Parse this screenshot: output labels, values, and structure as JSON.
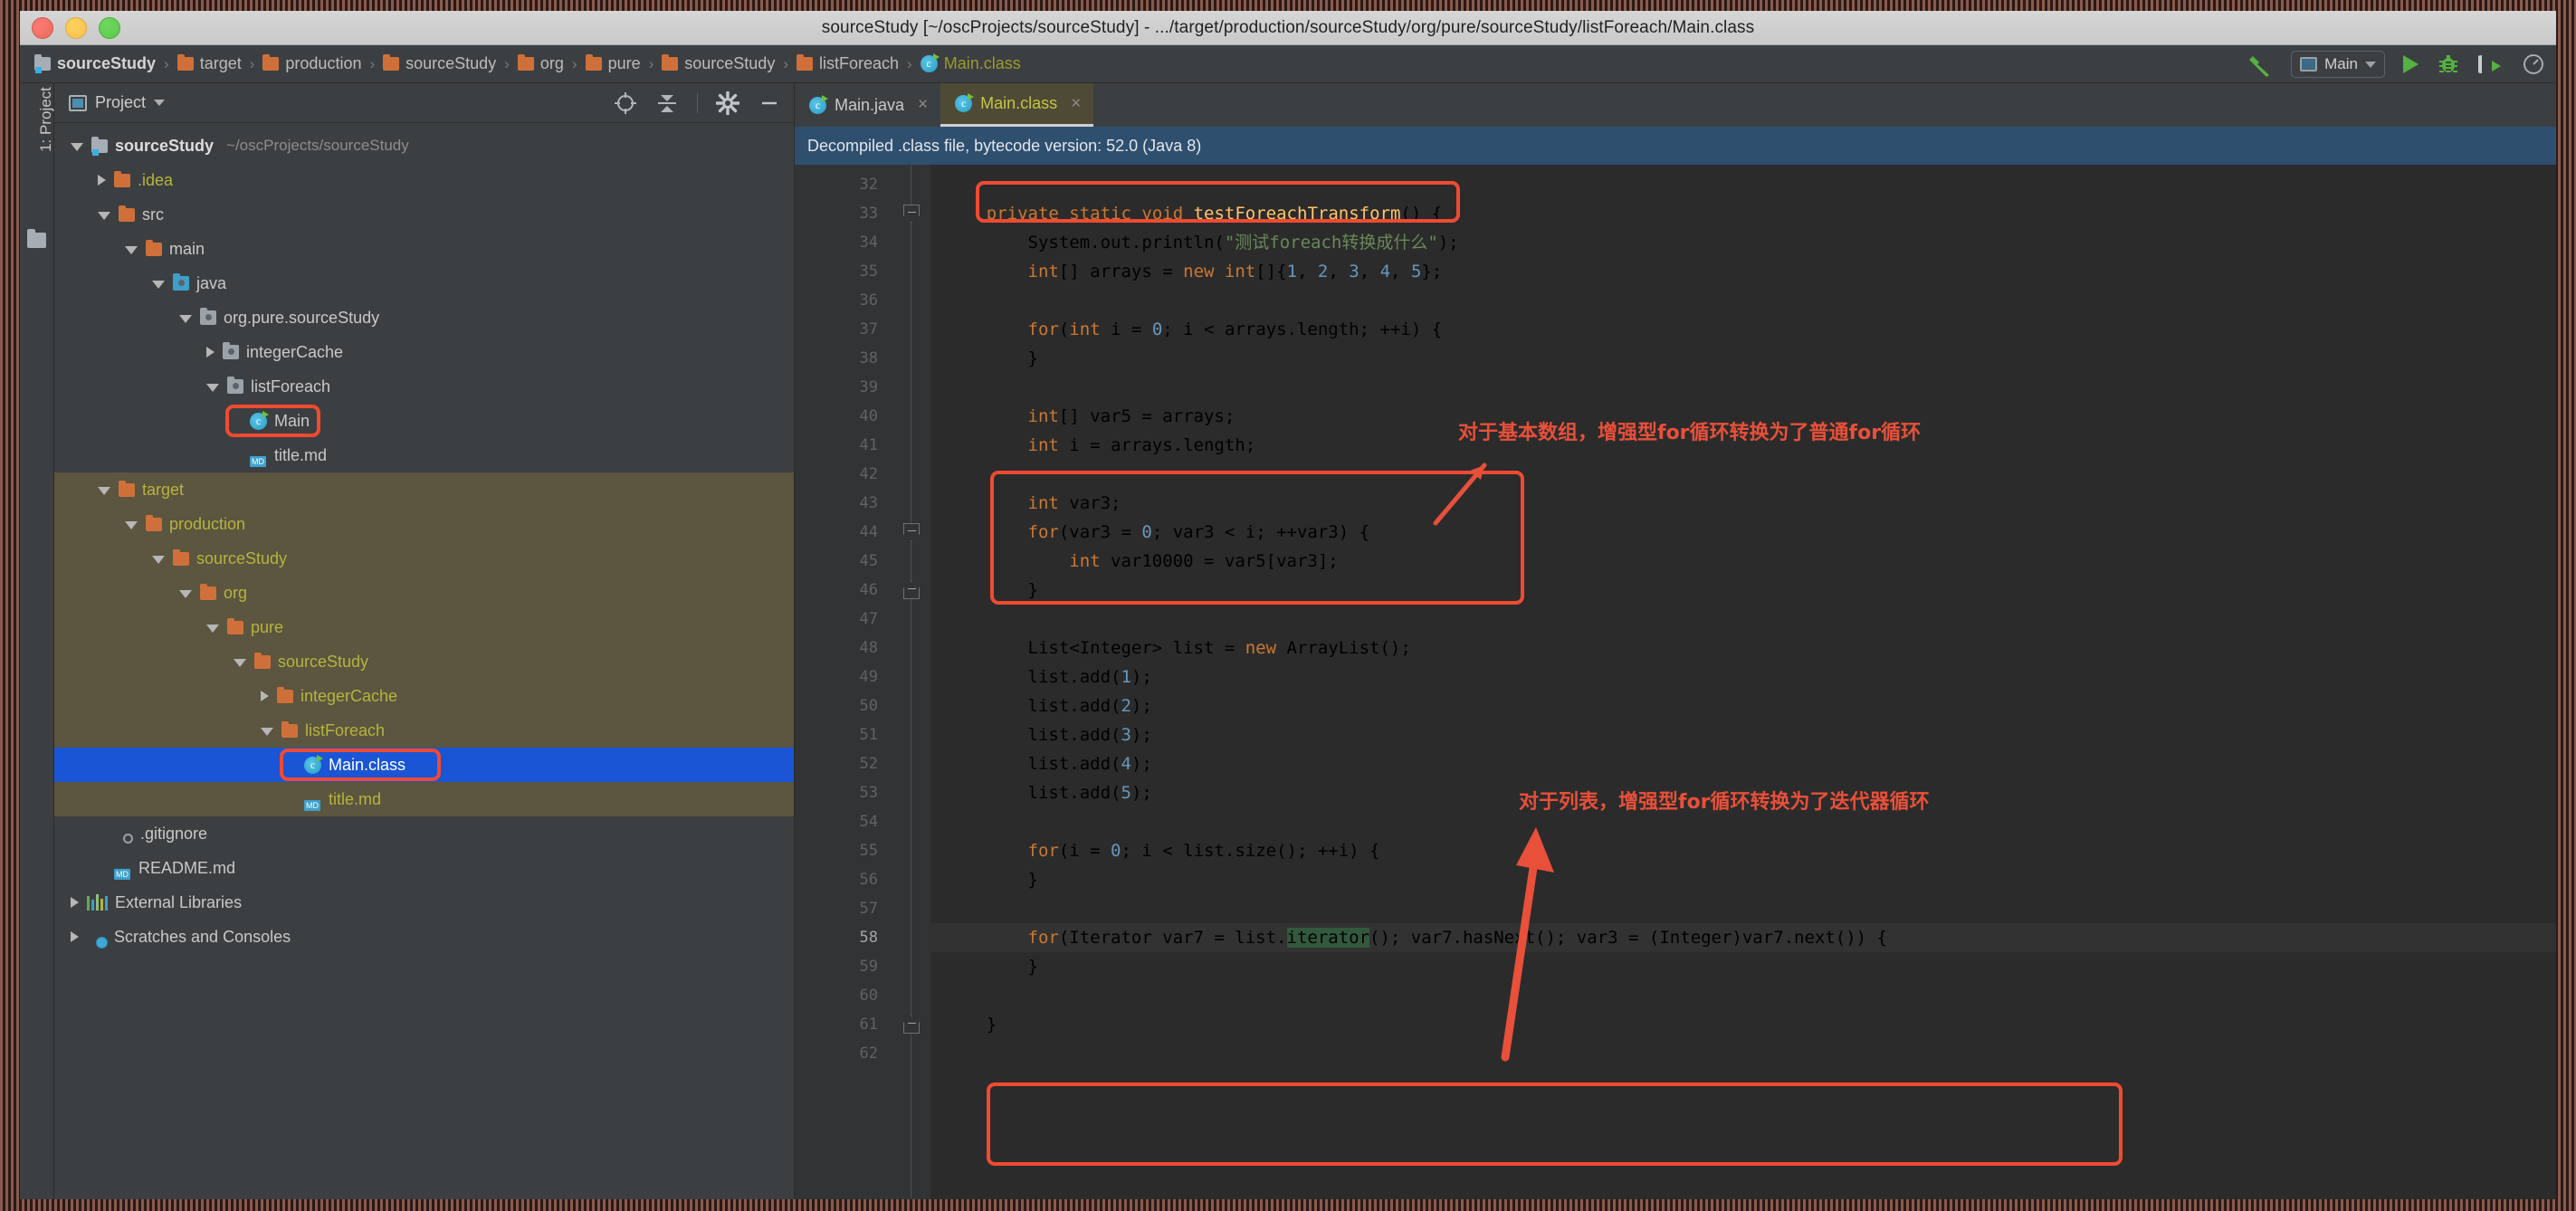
{
  "window": {
    "title": "sourceStudy [~/oscProjects/sourceStudy] - .../target/production/sourceStudy/org/pure/sourceStudy/listForeach/Main.class"
  },
  "breadcrumb": [
    {
      "label": "sourceStudy",
      "icon": "module-folder-icon",
      "kind": "module"
    },
    {
      "label": "target",
      "icon": "folder-icon",
      "kind": "folder"
    },
    {
      "label": "production",
      "icon": "folder-icon",
      "kind": "folder"
    },
    {
      "label": "sourceStudy",
      "icon": "folder-icon",
      "kind": "folder"
    },
    {
      "label": "org",
      "icon": "folder-icon",
      "kind": "folder"
    },
    {
      "label": "pure",
      "icon": "folder-icon",
      "kind": "folder"
    },
    {
      "label": "sourceStudy",
      "icon": "folder-icon",
      "kind": "folder"
    },
    {
      "label": "listForeach",
      "icon": "folder-icon",
      "kind": "folder"
    },
    {
      "label": "Main.class",
      "icon": "java-class-icon",
      "kind": "class"
    }
  ],
  "toolbar": {
    "build_icon": "hammer-icon",
    "run_config": "Main",
    "run_icon": "run-play-icon",
    "debug_icon": "debug-bug-icon",
    "run_coverage_icon": "run-with-coverage-icon",
    "profile_icon": "profiler-icon"
  },
  "left_strip": {
    "tool_tab": "1: Project",
    "icon": "project-folder-icon"
  },
  "project_panel": {
    "title": "Project",
    "tools": [
      "locate-icon",
      "collapse-all-icon",
      "gear-icon",
      "minimize-icon"
    ],
    "tree": [
      {
        "label": "sourceStudy",
        "hint": "~/oscProjects/sourceStudy",
        "depth": 0,
        "icon": "module-folder-icon",
        "state": "open",
        "style": "bold"
      },
      {
        "label": ".idea",
        "depth": 1,
        "icon": "folder-icon",
        "state": "closed",
        "style": "yellow"
      },
      {
        "label": "src",
        "depth": 1,
        "icon": "folder-icon",
        "state": "open",
        "style": "plain"
      },
      {
        "label": "main",
        "depth": 2,
        "icon": "folder-icon",
        "state": "open",
        "style": "plain"
      },
      {
        "label": "java",
        "depth": 3,
        "icon": "source-root-icon",
        "state": "open",
        "style": "plain"
      },
      {
        "label": "org.pure.sourceStudy",
        "depth": 4,
        "icon": "package-icon",
        "state": "open",
        "style": "plain"
      },
      {
        "label": "integerCache",
        "depth": 5,
        "icon": "package-icon",
        "state": "closed",
        "style": "plain"
      },
      {
        "label": "listForeach",
        "depth": 5,
        "icon": "package-icon",
        "state": "open",
        "style": "plain"
      },
      {
        "label": "Main",
        "depth": 6,
        "icon": "java-class-icon",
        "state": "leaf",
        "style": "plain",
        "highlight": "red-box"
      },
      {
        "label": "title.md",
        "depth": 6,
        "icon": "markdown-icon",
        "state": "leaf",
        "style": "plain"
      },
      {
        "label": "target",
        "depth": 1,
        "icon": "folder-icon",
        "state": "open",
        "style": "yellow",
        "bg": "excluded"
      },
      {
        "label": "production",
        "depth": 2,
        "icon": "folder-icon",
        "state": "open",
        "style": "yellow",
        "bg": "excluded"
      },
      {
        "label": "sourceStudy",
        "depth": 3,
        "icon": "folder-icon",
        "state": "open",
        "style": "yellow",
        "bg": "excluded"
      },
      {
        "label": "org",
        "depth": 4,
        "icon": "folder-icon",
        "state": "open",
        "style": "yellow",
        "bg": "excluded"
      },
      {
        "label": "pure",
        "depth": 5,
        "icon": "folder-icon",
        "state": "open",
        "style": "yellow",
        "bg": "excluded"
      },
      {
        "label": "sourceStudy",
        "depth": 6,
        "icon": "folder-icon",
        "state": "open",
        "style": "yellow",
        "bg": "excluded"
      },
      {
        "label": "integerCache",
        "depth": 7,
        "icon": "folder-icon",
        "state": "closed",
        "style": "yellow",
        "bg": "excluded"
      },
      {
        "label": "listForeach",
        "depth": 7,
        "icon": "folder-icon",
        "state": "open",
        "style": "yellow",
        "bg": "excluded"
      },
      {
        "label": "Main.class",
        "depth": 8,
        "icon": "java-class-icon",
        "state": "leaf",
        "style": "selected",
        "bg": "selected",
        "highlight": "red-box"
      },
      {
        "label": "title.md",
        "depth": 8,
        "icon": "markdown-icon",
        "state": "leaf",
        "style": "yellow",
        "bg": "excluded"
      },
      {
        "label": ".gitignore",
        "depth": 1,
        "icon": "gitignore-icon",
        "state": "leaf",
        "style": "plain"
      },
      {
        "label": "README.md",
        "depth": 1,
        "icon": "markdown-icon",
        "state": "leaf",
        "style": "plain"
      },
      {
        "label": "External Libraries",
        "depth": 0,
        "icon": "libraries-icon",
        "state": "closed",
        "style": "plain"
      },
      {
        "label": "Scratches and Consoles",
        "depth": 0,
        "icon": "scratches-icon",
        "state": "closed",
        "style": "plain"
      }
    ]
  },
  "editor": {
    "tabs": [
      {
        "label": "Main.java",
        "icon": "java-class-icon",
        "active": false,
        "close": "×"
      },
      {
        "label": "Main.class",
        "icon": "java-class-icon",
        "active": true,
        "close": "×"
      }
    ],
    "notice": "Decompiled .class file, bytecode version: 52.0 (Java 8)",
    "first_line": 32,
    "lines": [
      {
        "no": 32,
        "text": ""
      },
      {
        "no": 33,
        "text": "    private static void testForeachTransform() {",
        "fold": "down"
      },
      {
        "no": 34,
        "text": "        System.out.println(\"测试foreach转换成什么\");"
      },
      {
        "no": 35,
        "text": "        int[] arrays = new int[]{1, 2, 3, 4, 5};"
      },
      {
        "no": 36,
        "text": ""
      },
      {
        "no": 37,
        "text": "        for(int i = 0; i < arrays.length; ++i) {"
      },
      {
        "no": 38,
        "text": "        }"
      },
      {
        "no": 39,
        "text": ""
      },
      {
        "no": 40,
        "text": "        int[] var5 = arrays;"
      },
      {
        "no": 41,
        "text": "        int i = arrays.length;"
      },
      {
        "no": 42,
        "text": ""
      },
      {
        "no": 43,
        "text": "        int var3;"
      },
      {
        "no": 44,
        "text": "        for(var3 = 0; var3 < i; ++var3) {",
        "fold": "down"
      },
      {
        "no": 45,
        "text": "            int var10000 = var5[var3];"
      },
      {
        "no": 46,
        "text": "        }",
        "fold": "up"
      },
      {
        "no": 47,
        "text": ""
      },
      {
        "no": 48,
        "text": "        List<Integer> list = new ArrayList();"
      },
      {
        "no": 49,
        "text": "        list.add(1);"
      },
      {
        "no": 50,
        "text": "        list.add(2);"
      },
      {
        "no": 51,
        "text": "        list.add(3);"
      },
      {
        "no": 52,
        "text": "        list.add(4);"
      },
      {
        "no": 53,
        "text": "        list.add(5);"
      },
      {
        "no": 54,
        "text": ""
      },
      {
        "no": 55,
        "text": "        for(i = 0; i < list.size(); ++i) {"
      },
      {
        "no": 56,
        "text": "        }"
      },
      {
        "no": 57,
        "text": ""
      },
      {
        "no": 58,
        "text": "        for(Iterator var7 = list.iterator(); var7.hasNext(); var3 = (Integer)var7.next()) {",
        "current": true
      },
      {
        "no": 59,
        "text": "        }"
      },
      {
        "no": 60,
        "text": ""
      },
      {
        "no": 61,
        "text": "    }",
        "fold": "up"
      },
      {
        "no": 62,
        "text": ""
      }
    ],
    "annotations": [
      {
        "text": "对于基本数组，增强型for循环转换为了普通for循环",
        "color": "#e8503a"
      },
      {
        "text": "对于列表，增强型for循环转换为了迭代器循环",
        "color": "#e8503a"
      }
    ],
    "highlight_boxes": [
      {
        "target": "line-33-signature"
      },
      {
        "target": "lines-43-46-basic-for"
      },
      {
        "target": "lines-58-59-iterator-for"
      }
    ]
  },
  "colors": {
    "accent_red": "#f04a32",
    "selection_blue": "#1a55d6",
    "excluded_bg": "#5c553f",
    "notice_bg": "#2f4f6f",
    "keyword": "#cc7832",
    "string": "#6a8759",
    "number": "#6897bb",
    "method": "#ffc66d",
    "plain": "#a9b7c6"
  }
}
